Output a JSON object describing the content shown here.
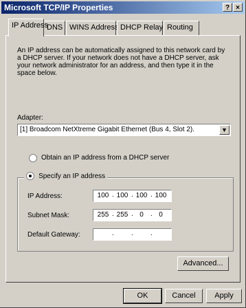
{
  "window": {
    "title": "Microsoft TCP/IP Properties",
    "help_label": "?",
    "close_label": "×"
  },
  "tabs": [
    {
      "label": "IP Address"
    },
    {
      "label": "DNS"
    },
    {
      "label": "WINS Address"
    },
    {
      "label": "DHCP Relay"
    },
    {
      "label": "Routing"
    }
  ],
  "description": "An IP address can be automatically assigned to this network card by a DHCP server.  If your network does not have a DHCP server, ask your network administrator for an address, and then type it in the space below.",
  "adapter": {
    "label": "Adapter:",
    "value": "[1] Broadcom NetXtreme Gigabit Ethernet (Bus 4, Slot 2).",
    "dropdown_icon": "chevron-down-icon"
  },
  "radios": {
    "dhcp_label": "Obtain an IP address from a DHCP server",
    "specify_label": "Specify an IP address",
    "selected": "specify"
  },
  "fields": {
    "ip_label": "IP Address:",
    "ip": [
      "100",
      "100",
      "100",
      "100"
    ],
    "mask_label": "Subnet Mask:",
    "mask": [
      "255",
      "255",
      "0",
      "0"
    ],
    "gateway_label": "Default Gateway:",
    "gateway": [
      "",
      "",
      "",
      ""
    ]
  },
  "buttons": {
    "advanced": "Advanced...",
    "ok": "OK",
    "cancel": "Cancel",
    "apply": "Apply"
  }
}
